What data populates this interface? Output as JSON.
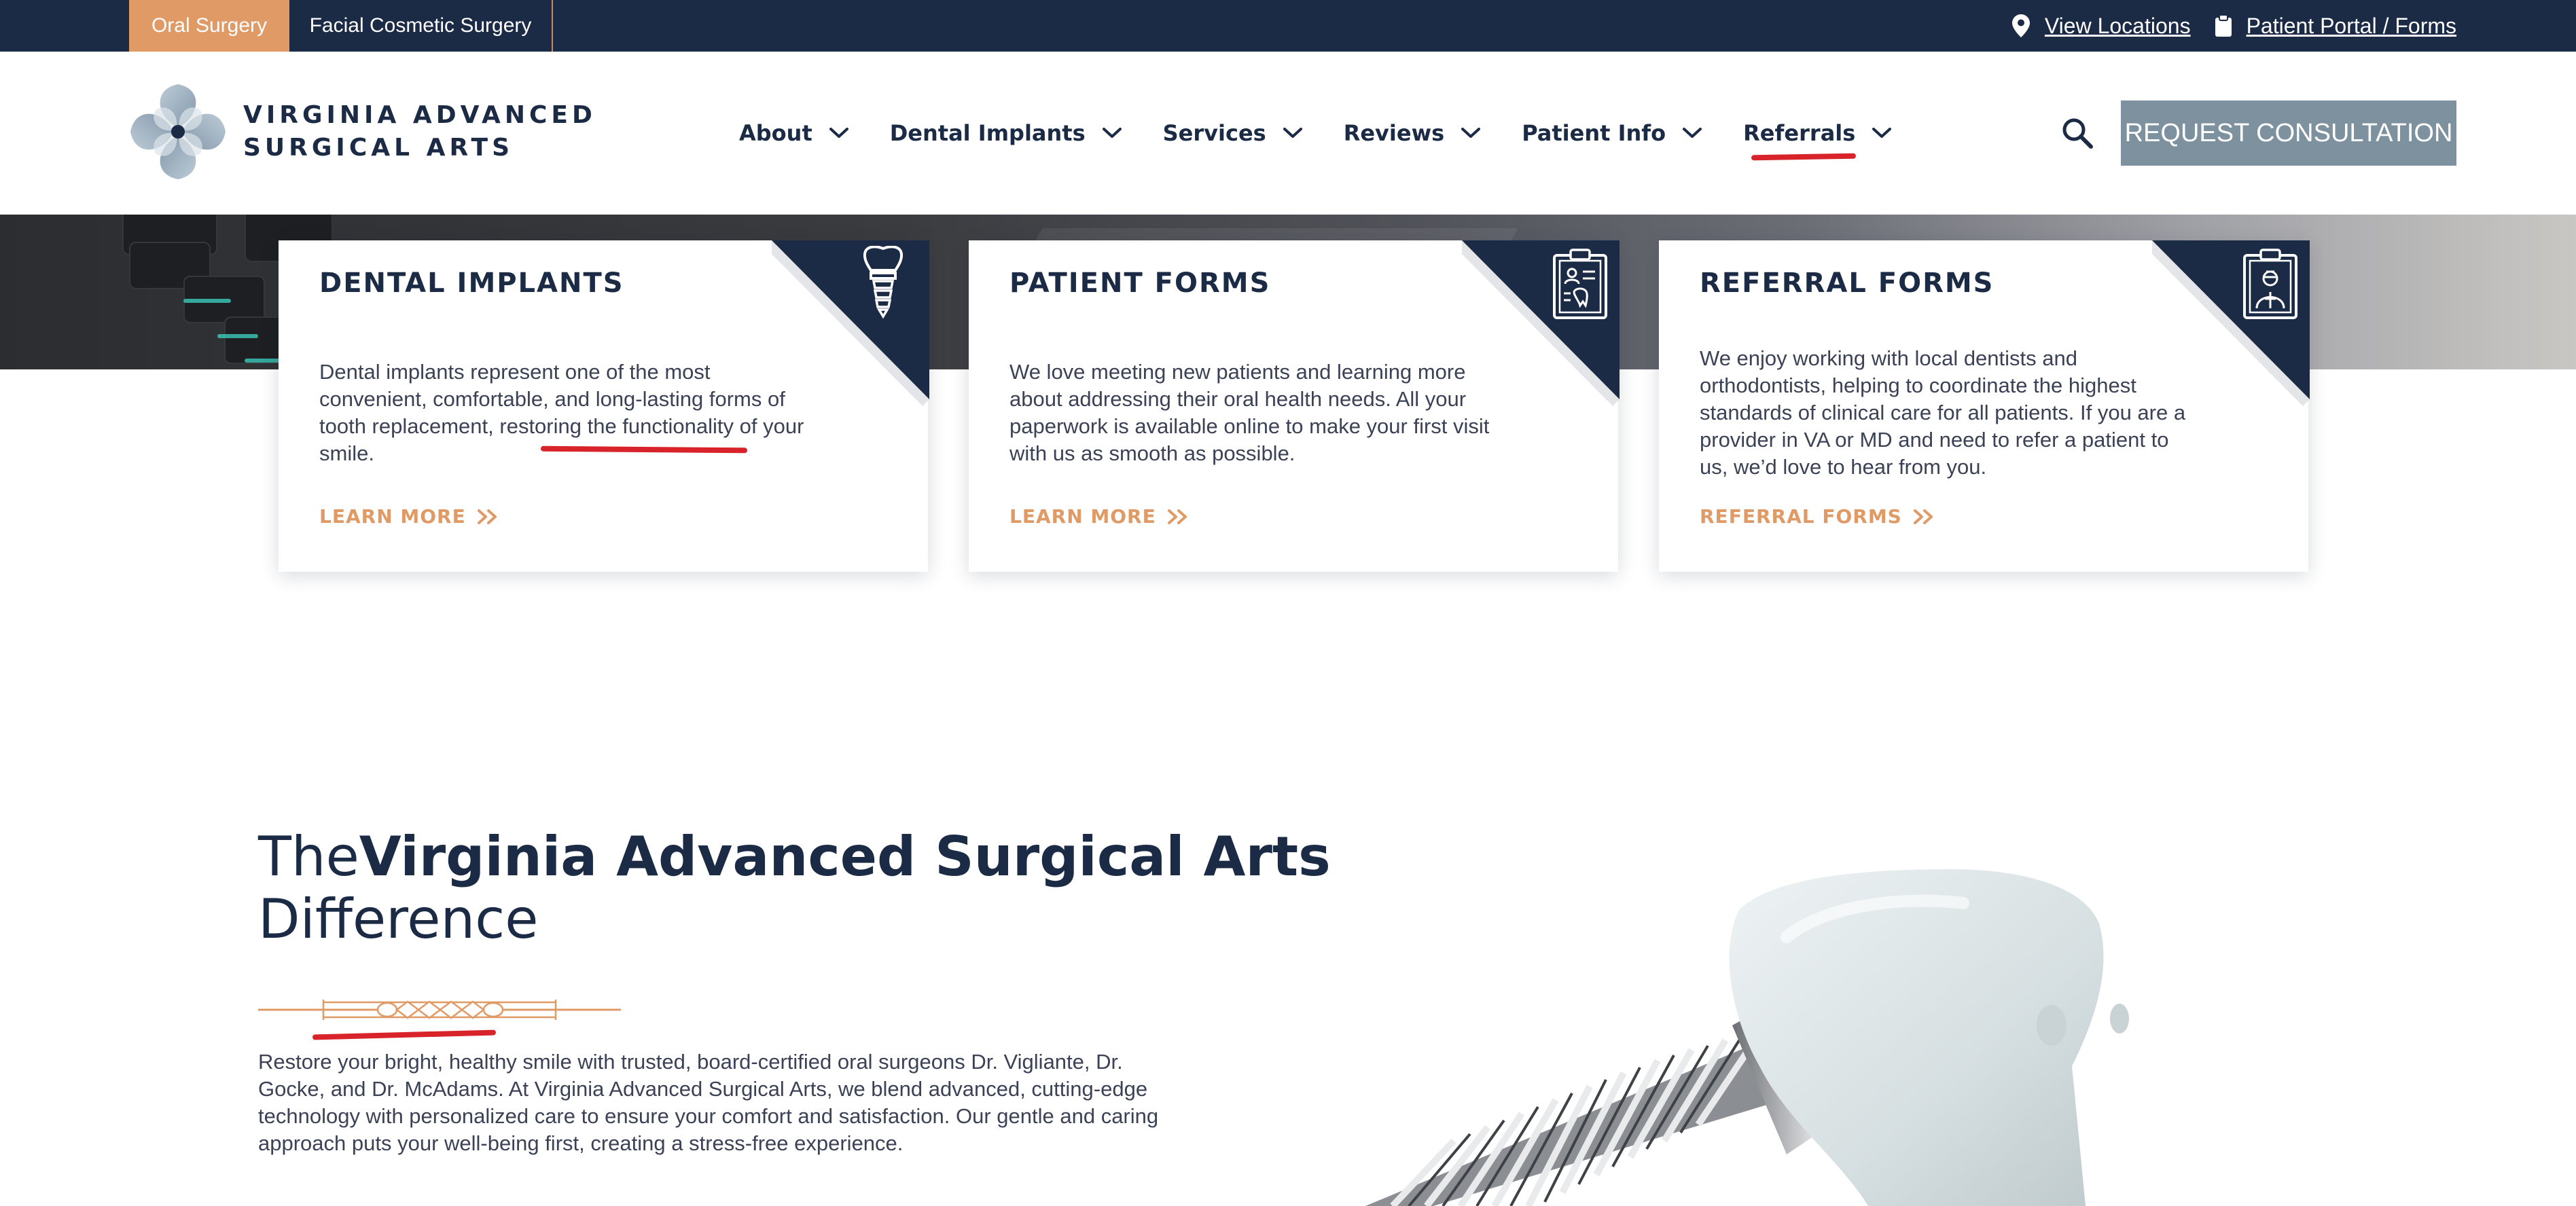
{
  "topbar": {
    "tabs": [
      {
        "label": "Oral Surgery",
        "active": true
      },
      {
        "label": "Facial Cosmetic Surgery",
        "active": false
      }
    ],
    "links": {
      "locations": "View Locations",
      "portal": "Patient Portal / Forms"
    }
  },
  "header": {
    "logo_line1": "VIRGINIA ADVANCED",
    "logo_line2": "SURGICAL ARTS",
    "nav": [
      "About",
      "Dental Implants",
      "Services",
      "Reviews",
      "Patient Info",
      "Referrals"
    ],
    "cta": "REQUEST CONSULTATION"
  },
  "cards": [
    {
      "title": "DENTAL IMPLANTS",
      "icon": "tooth-implant-icon",
      "text": "Dental implants represent one of the most convenient, comfortable, and long-lasting forms of tooth replacement, restoring the functionality of your smile.",
      "link": "LEARN MORE"
    },
    {
      "title": "PATIENT FORMS",
      "icon": "clipboard-tooth-icon",
      "text": "We love meeting new patients and learning more about addressing their oral health needs. All your paperwork is available online to make your first visit with us as smooth as possible.",
      "link": "LEARN MORE"
    },
    {
      "title": "REFERRAL FORMS",
      "icon": "clipboard-doctor-icon",
      "text": "We enjoy working with local dentists and orthodontists, helping to coordinate the highest standards of clinical care for all patients. If you are a provider in VA or MD and need to refer a patient to us, we’d love to hear from you.",
      "link": "REFERRAL FORMS"
    }
  ],
  "difference": {
    "title_pre": "The",
    "title_bold": "Virginia Advanced Surgical Arts",
    "title_post": "Difference",
    "body": "Restore your bright, healthy smile with trusted, board-certified oral surgeons Dr. Vigliante, Dr. Gocke, and Dr. McAdams. At Virginia Advanced Surgical Arts, we blend advanced, cutting-edge technology with personalized care to ensure your comfort and satisfaction. Our gentle and caring approach puts your well-being first, creating a stress-free experience."
  },
  "colors": {
    "navy": "#1b2a45",
    "accent_orange": "#e09a66",
    "cta_gray": "#7d919e",
    "annotation_red": "#d8232a"
  }
}
